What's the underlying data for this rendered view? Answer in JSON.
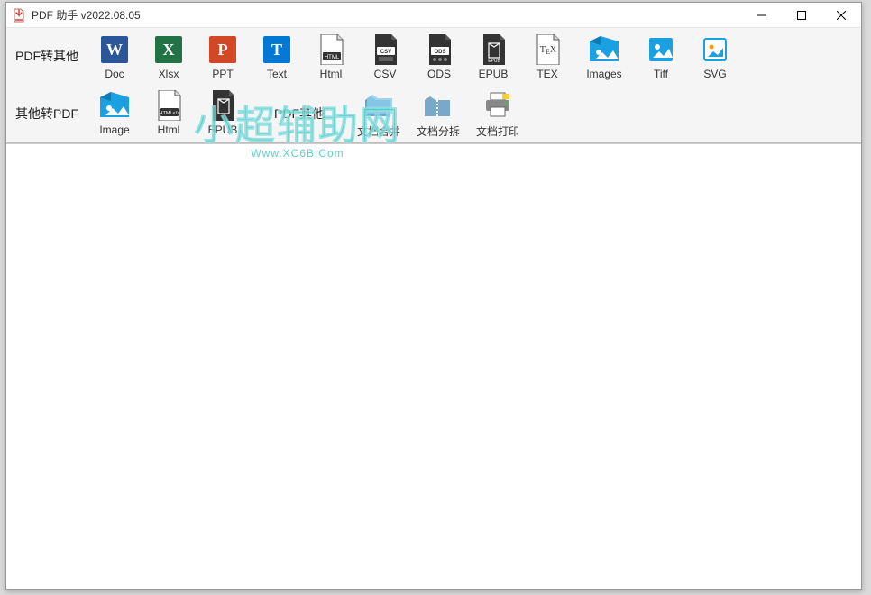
{
  "title": "PDF 助手 v2022.08.05",
  "row1": {
    "label": "PDF转其他",
    "tools": [
      {
        "label": "Doc"
      },
      {
        "label": "Xlsx"
      },
      {
        "label": "PPT"
      },
      {
        "label": "Text"
      },
      {
        "label": "Html"
      },
      {
        "label": "CSV"
      },
      {
        "label": "ODS"
      },
      {
        "label": "EPUB"
      },
      {
        "label": "TEX"
      },
      {
        "label": "Images"
      },
      {
        "label": "Tiff"
      },
      {
        "label": "SVG"
      }
    ]
  },
  "row2a": {
    "label": "其他转PDF",
    "tools": [
      {
        "label": "Image"
      },
      {
        "label": "Html"
      },
      {
        "label": "EPUB"
      }
    ]
  },
  "row2b": {
    "label": "PDF其他",
    "tools": [
      {
        "label": "文档合并"
      },
      {
        "label": "文档分拆"
      },
      {
        "label": "文档打印"
      }
    ]
  },
  "watermark": {
    "big": "小超辅助网",
    "small": "Www.XC6B.Com"
  }
}
